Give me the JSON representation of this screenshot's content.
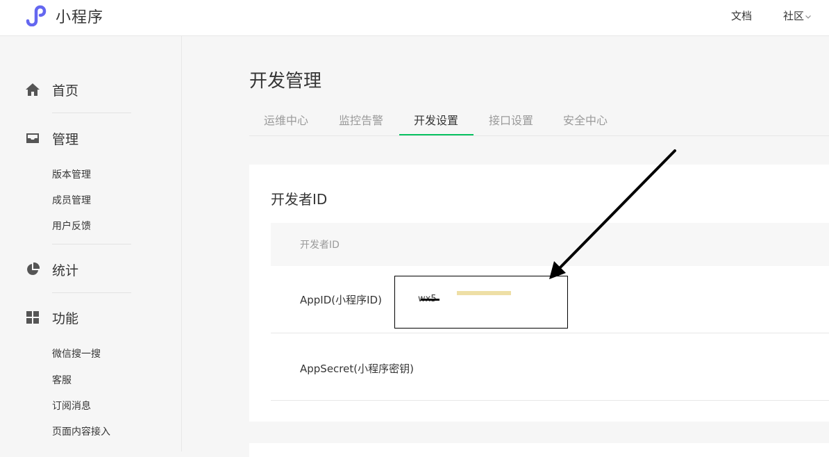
{
  "header": {
    "brand": "小程序",
    "links": {
      "docs": "文档",
      "community": "社区"
    }
  },
  "sidebar": {
    "home": "首页",
    "manage": {
      "title": "管理",
      "items": [
        "版本管理",
        "成员管理",
        "用户反馈"
      ]
    },
    "stats": "统计",
    "features": {
      "title": "功能",
      "items": [
        "微信搜一搜",
        "客服",
        "订阅消息",
        "页面内容接入"
      ]
    }
  },
  "main": {
    "title": "开发管理",
    "tabs": [
      "运维中心",
      "监控告警",
      "开发设置",
      "接口设置",
      "安全中心"
    ],
    "active_tab": "开发设置",
    "card": {
      "title": "开发者ID",
      "table_header": "开发者ID",
      "rows": [
        {
          "label": "AppID(小程序ID)",
          "value": "wx5"
        },
        {
          "label": "AppSecret(小程序密钥)",
          "value": ""
        }
      ]
    }
  },
  "colors": {
    "accent": "#07c160",
    "logo": "#6467f0",
    "annotation": "#000000",
    "highlight": "#eedfa6"
  }
}
